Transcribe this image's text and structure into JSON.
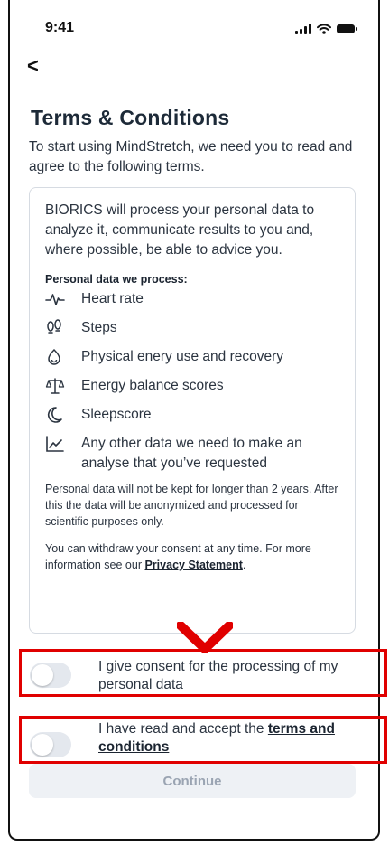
{
  "status_bar": {
    "time": "9:41",
    "icons": [
      "signal-icon",
      "wifi-icon",
      "battery-icon"
    ]
  },
  "nav": {
    "back_glyph": "<"
  },
  "page": {
    "title": "Terms & Conditions",
    "intro": "To start using MindStretch, we need you to read and agree to the following terms."
  },
  "card": {
    "lead": "BIORICS will process your personal data to analyze it, communicate results to you and, where possible, be able to advice you.",
    "subhead": "Personal data we process:",
    "items": [
      {
        "icon": "heart-rate-icon",
        "label": "Heart rate"
      },
      {
        "icon": "footsteps-icon",
        "label": "Steps"
      },
      {
        "icon": "recovery-icon",
        "label": "Physical enery use and recovery"
      },
      {
        "icon": "balance-scale-icon",
        "label": "Energy balance scores"
      },
      {
        "icon": "moon-icon",
        "label": "Sleepscore"
      },
      {
        "icon": "line-chart-icon",
        "label": "Any other data we need to make an analyse that you’ve requested"
      }
    ],
    "retention_note": "Personal data will not be kept for longer than 2 years. After this the data will be anonymized and processed for scientific purposes only.",
    "withdraw_note_prefix": "You can withdraw your consent at any time. For more information see our ",
    "privacy_link": "Privacy Statement",
    "withdraw_note_suffix": "."
  },
  "consents": {
    "personal_data": {
      "label": "I give consent for the processing of my personal data",
      "checked": false
    },
    "terms": {
      "label_prefix": "I have read and accept the ",
      "link": "terms and conditions",
      "checked": false
    }
  },
  "continue_label": "Continue",
  "colors": {
    "highlight": "#e00000",
    "toggle_off": "#e4e8ee",
    "button_disabled_bg": "#eef1f5",
    "button_disabled_text": "#9aa4b2"
  }
}
